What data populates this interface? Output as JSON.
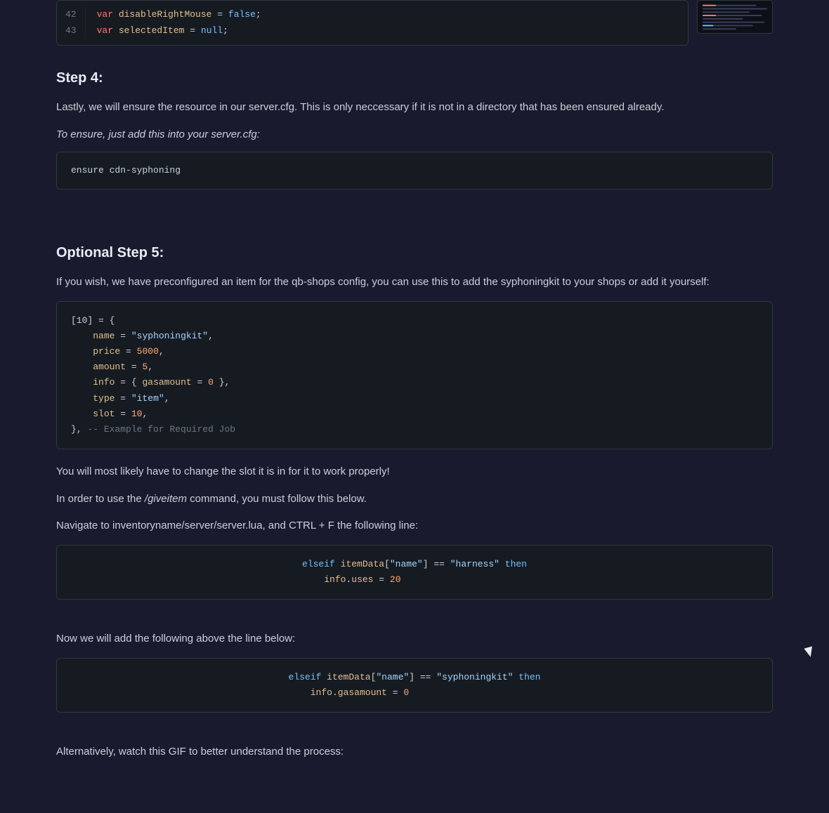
{
  "top_code": {
    "lines": [
      {
        "num": "42",
        "code_html": "<span class='var-keyword'>var</span> <span class='var-name'>disableRightMouse</span> <span class='op-white'>=</span> <span class='var-value-false'>false</span><span class='op-white'>;</span>"
      },
      {
        "num": "43",
        "code_html": "<span class='var-keyword'>var</span> <span class='var-name'>selectedItem</span> <span class='op-white'>=</span> <span class='var-value-null'>null</span><span class='op-white'>;</span>"
      }
    ]
  },
  "step4": {
    "heading": "Step 4:",
    "body1": "Lastly, we will ensure the resource in our server.cfg. This is only neccessary if it is not in a directory that has been ensured already.",
    "italic": "To ensure, just add this into your server.cfg:",
    "code": "ensure cdn-syphoning"
  },
  "step5": {
    "heading": "Optional Step 5:",
    "body1": "If you wish, we have preconfigured an item for the qb-shops config, you can use this to add the syphoningkit to your shops or add it yourself:",
    "code_lines": [
      {
        "html": "<span class='op-white'>[10] = {</span>"
      },
      {
        "html": "    <span class='var-name'>name</span> <span class='op-white'>=</span> <span class='str-green'>\"syphoningkit\"</span><span class='op-white'>,</span>"
      },
      {
        "html": "    <span class='var-name'>price</span> <span class='op-white'>=</span> <span class='num-orange'>5000</span><span class='op-white'>,</span>"
      },
      {
        "html": "    <span class='var-name'>amount</span> <span class='op-white'>=</span> <span class='num-orange'>5</span><span class='op-white'>,</span>"
      },
      {
        "html": "    <span class='var-name'>info</span> <span class='op-white'>= {</span> <span class='var-name'>gasamount</span> <span class='op-white'>=</span> <span class='num-orange'>0</span> <span class='op-white'>},</span>"
      },
      {
        "html": "    <span class='var-name'>type</span> <span class='op-white'>=</span> <span class='str-green'>\"item\"</span><span class='op-white'>,</span>"
      },
      {
        "html": "    <span class='var-name'>slot</span> <span class='op-white'>=</span> <span class='num-orange'>10</span><span class='op-white'>,</span>"
      },
      {
        "html": "<span class='op-white'>},</span> <span class='comment-gray'>-- Example for Required Job</span>"
      }
    ],
    "body2": "You will most likely have to change the slot it is in for it to work properly!",
    "body3": "In order to use the /giveitem command, you must follow this below.",
    "body3_italic": "/giveitem",
    "body4": "Navigate to inventoryname/server/server.lua, and CTRL + F the following line:",
    "code2_lines": [
      {
        "html": "<span class='kw-blue'>elseif</span> <span class='var-name'>itemData</span><span class='op-white'>[</span><span class='str-green'>\"name\"</span><span class='op-white'>]</span> <span class='op-white'>==</span> <span class='str-green'>\"harness\"</span> <span class='kw-blue'>then</span>"
      },
      {
        "html": "    <span class='var-name'>info</span><span class='op-white'>.</span><span class='var-name'>uses</span> <span class='op-white'>=</span> <span class='num-orange'>20</span>"
      }
    ],
    "body5": "Now we will add the following above the line below:",
    "code3_lines": [
      {
        "html": "<span class='kw-blue'>elseif</span> <span class='var-name'>itemData</span><span class='op-white'>[</span><span class='str-green'>\"name\"</span><span class='op-white'>]</span> <span class='op-white'>==</span> <span class='str-green'>\"syphoningkit\"</span> <span class='kw-blue'>then</span>"
      },
      {
        "html": "    <span class='var-name'>info</span><span class='op-white'>.</span><span class='var-name'>gasamount</span> <span class='op-white'>=</span> <span class='num-orange'>0</span>"
      }
    ],
    "body6": "Alternatively, watch this GIF to better understand the process:"
  }
}
